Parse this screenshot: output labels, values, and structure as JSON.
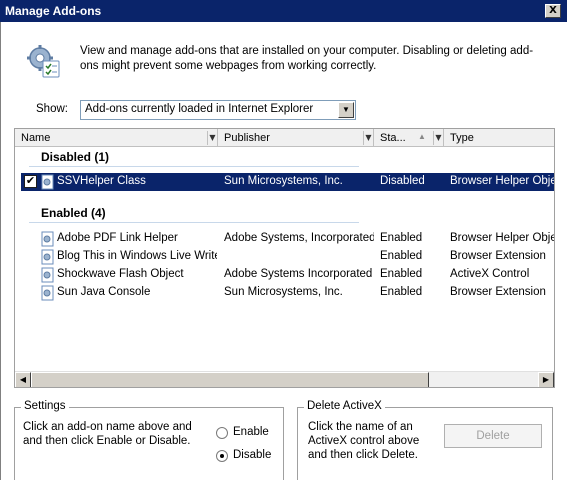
{
  "window": {
    "title": "Manage Add-ons",
    "close_glyph": "X"
  },
  "description": "View and manage add-ons that are installed on your computer. Disabling or deleting add-ons might prevent some webpages from working correctly.",
  "show": {
    "label": "Show:",
    "selected": "Add-ons currently loaded in Internet Explorer",
    "icon": "chevron-down-icon"
  },
  "columns": [
    "Name",
    "Publisher",
    "Sta...",
    "Type"
  ],
  "groups": [
    {
      "title": "Disabled (1)",
      "rows": [
        {
          "name": "SSVHelper Class",
          "publisher": "Sun Microsystems, Inc.",
          "status": "Disabled",
          "type": "Browser Helper Object",
          "selected": true,
          "checked": true
        }
      ]
    },
    {
      "title": "Enabled (4)",
      "rows": [
        {
          "name": "Adobe PDF Link Helper",
          "publisher": "Adobe Systems, Incorporated",
          "status": "Enabled",
          "type": "Browser Helper Object"
        },
        {
          "name": "Blog This in Windows Live Writer",
          "publisher": "",
          "status": "Enabled",
          "type": "Browser Extension"
        },
        {
          "name": "Shockwave Flash Object",
          "publisher": "Adobe Systems Incorporated",
          "status": "Enabled",
          "type": "ActiveX Control"
        },
        {
          "name": "Sun Java Console",
          "publisher": "Sun Microsystems, Inc.",
          "status": "Enabled",
          "type": "Browser Extension"
        }
      ]
    }
  ],
  "settings": {
    "legend": "Settings",
    "text": "Click an add-on name above and and then click Enable or Disable.",
    "enable_label": "Enable",
    "disable_label": "Disable",
    "selected": "Disable"
  },
  "delete_activex": {
    "legend": "Delete ActiveX",
    "text": "Click the name of an ActiveX control above and then click Delete.",
    "button": "Delete"
  }
}
